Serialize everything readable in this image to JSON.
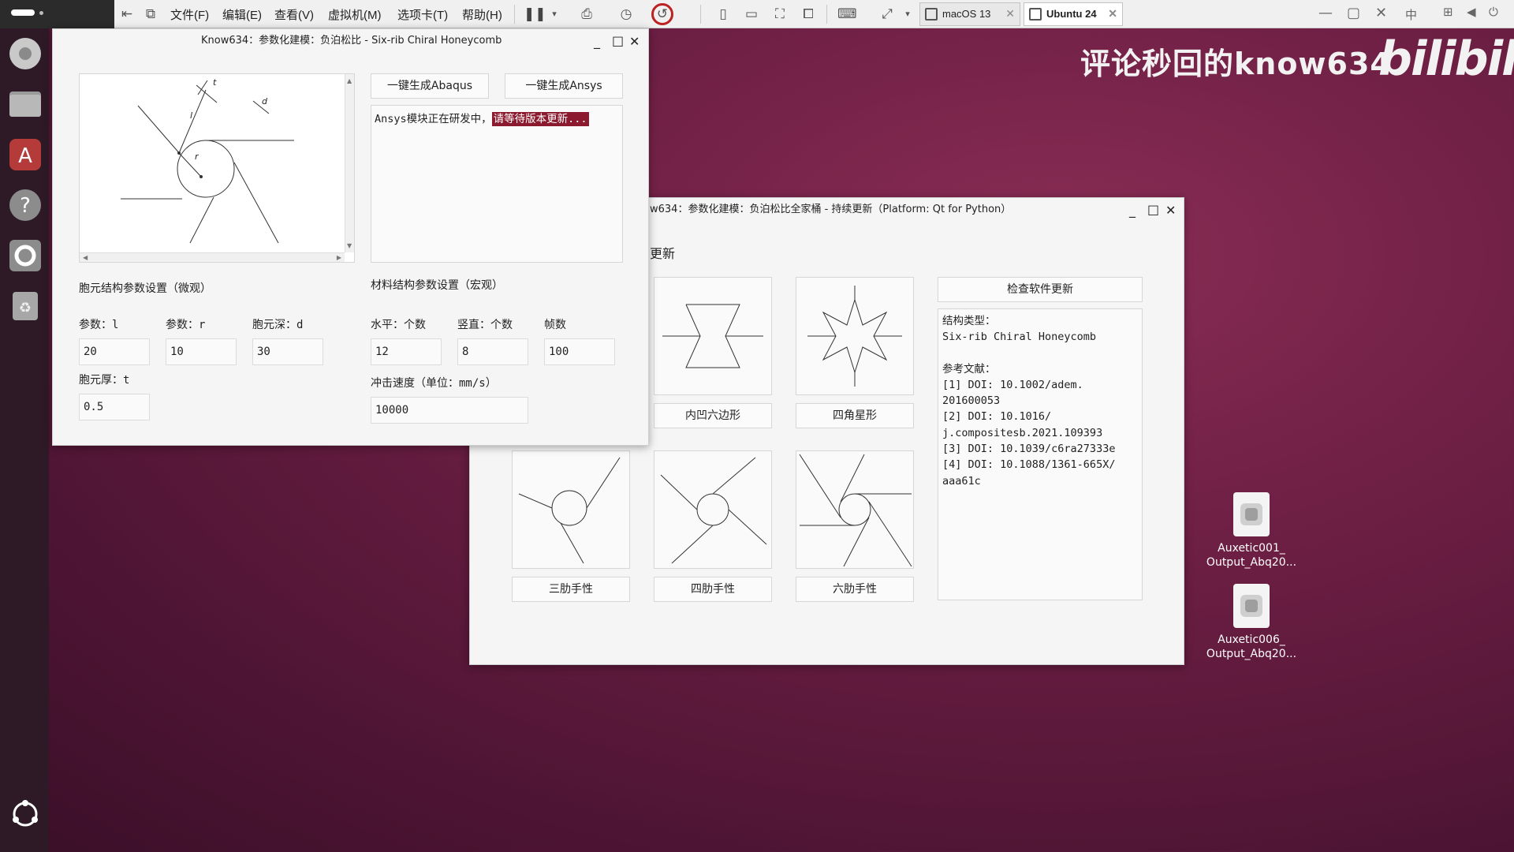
{
  "vmware": {
    "menus": [
      "文件(F)",
      "编辑(E)",
      "查看(V)",
      "虚拟机(M)",
      "选项卡(T)",
      "帮助(H)"
    ],
    "tabs": [
      {
        "label": "macOS 13",
        "active": false
      },
      {
        "label": "Ubuntu 24",
        "active": true
      }
    ],
    "ime": "中"
  },
  "desktop": {
    "watermark": "评论秒回的know634",
    "logo_text": "bilibili",
    "files": [
      {
        "line1": "Auxetic001_",
        "line2": "Output_Abq20..."
      },
      {
        "line1": "Auxetic006_",
        "line2": "Output_Abq20..."
      }
    ]
  },
  "win1": {
    "title": "Know634：参数化建模：负泊松比 - Six-rib Chiral Honeycomb",
    "btn_abaqus": "一键生成Abaqus",
    "btn_ansys": "一键生成Ansys",
    "log_text": "Ansys模块正在研发中，",
    "log_highlight": "请等待版本更新...",
    "diagram_labels": {
      "t": "t",
      "l": "l",
      "r": "r",
      "d": "d"
    },
    "micro_title": "胞元结构参数设置（微观）",
    "macro_title": "材料结构参数设置（宏观）",
    "param_l_label": "参数：l",
    "param_l": "20",
    "param_r_label": "参数：r",
    "param_r": "10",
    "param_d_label": "胞元深：d",
    "param_d": "30",
    "param_t_label": "胞元厚：t",
    "param_t": "0.5",
    "horiz_label": "水平：个数",
    "horiz": "12",
    "vert_label": "竖直：个数",
    "vert": "8",
    "frames_label": "帧数",
    "frames": "100",
    "speed_label": "冲击速度（单位：mm/s）",
    "speed": "10000"
  },
  "win2": {
    "title": "w634：参数化建模：负泊松比全家桶 - 持续更新（Platform: Qt for Python）",
    "heading": "更新",
    "check_update": "检查软件更新",
    "structures": [
      {
        "label": "内凹六边形"
      },
      {
        "label": "四角星形"
      },
      {
        "label": "三肋手性"
      },
      {
        "label": "四肋手性"
      },
      {
        "label": "六肋手性"
      }
    ],
    "info_lines": [
      "结构类型：",
      "Six-rib Chiral Honeycomb",
      "",
      "参考文献：",
      "[1] DOI: 10.1002/adem.",
      "201600053",
      "[2] DOI: 10.1016/",
      "j.compositesb.2021.109393",
      "[3] DOI: 10.1039/c6ra27333e",
      "[4] DOI: 10.1088/1361-665X/",
      "aaa61c"
    ]
  }
}
